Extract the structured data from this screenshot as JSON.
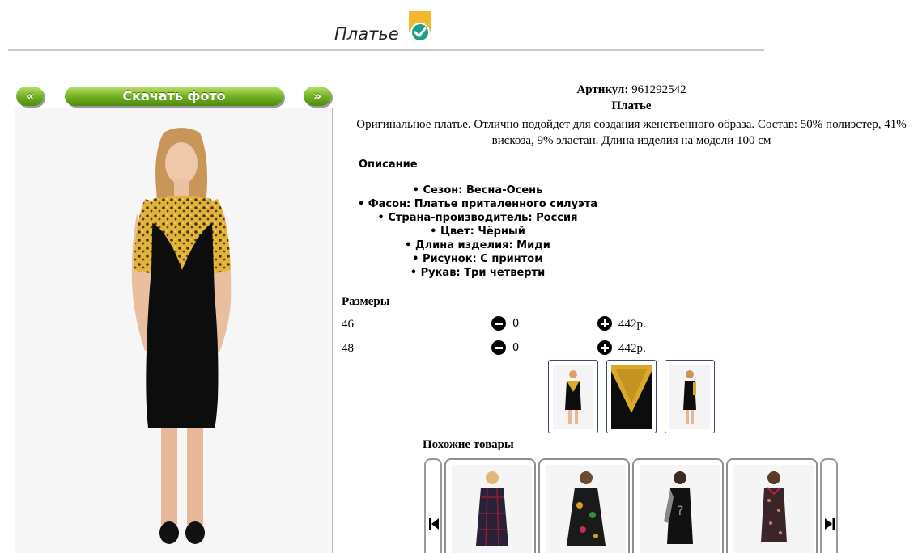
{
  "header": {
    "title": "Платье"
  },
  "gallery": {
    "prev_label": "«",
    "download_label": "Скачать фото",
    "next_label": "»"
  },
  "product": {
    "article_label": "Артикул:",
    "article_value": "961292542",
    "name": "Платье",
    "description": "Оригинальное платье. Отлично подойдет для создания женственного образа. Состав: 50% полиэстер, 41% вискоза, 9% эластан. Длина изделия на модели 100 см"
  },
  "attributes": {
    "heading": "Описание",
    "items": [
      "Сезон: Весна-Осень",
      "Фасон: Платье приталенного силуэта",
      "Страна-производитель: Россия",
      "Цвет: Чёрный",
      "Длина изделия: Миди",
      "Рисунок: С принтом",
      "Рукав: Три четверти"
    ]
  },
  "sizes": {
    "heading": "Размеры",
    "rows": [
      {
        "size": "46",
        "qty": "0",
        "price": "442р."
      },
      {
        "size": "48",
        "qty": "0",
        "price": "442р."
      }
    ]
  },
  "similar": {
    "heading": "Похожие товары"
  },
  "colors": {
    "dress_black": "#0d0d0d",
    "print_yellow": "#d9a92a",
    "accent_green": "#6fae1f",
    "badge_yellow": "#f3b92e",
    "badge_teal": "#1aa08a"
  }
}
